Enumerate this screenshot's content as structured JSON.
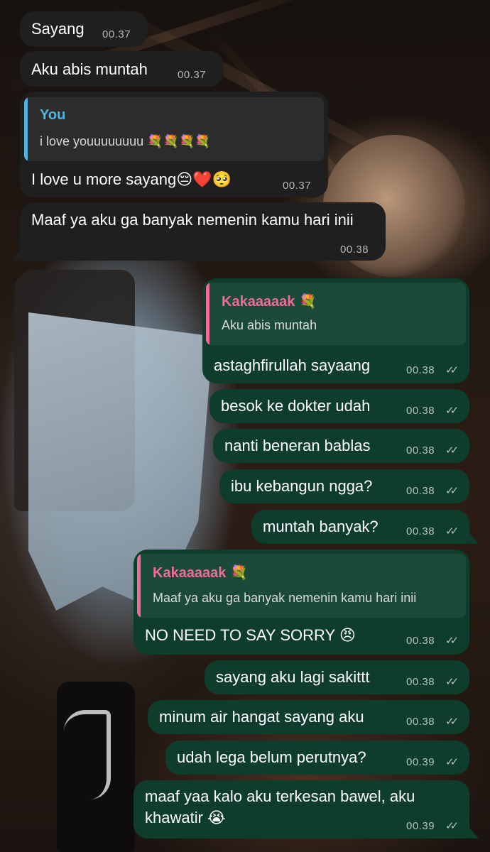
{
  "colors": {
    "incoming_bubble": "#1f1f1f",
    "outgoing_bubble": "#0f3d2c",
    "quote_you": "#4fb3e0",
    "quote_kakaaaak": "#f06a9a"
  },
  "incoming": [
    {
      "text": "Sayang",
      "time": "00.37"
    },
    {
      "text": "Aku abis muntah",
      "time": "00.37"
    },
    {
      "quote_name": "You",
      "quote_text": "i love youuuuuuuu 💐💐💐💐",
      "text": "I love u more sayang😔❤️🥺",
      "time": "00.37"
    },
    {
      "text": "Maaf ya aku ga banyak nemenin kamu hari inii",
      "time": "00.38"
    }
  ],
  "outgoing": [
    {
      "quote_name": "Kakaaaaak 💐",
      "quote_text": "Aku abis muntah",
      "text": "astaghfirullah sayaang",
      "time": "00.38"
    },
    {
      "text": "besok ke dokter udah",
      "time": "00.38"
    },
    {
      "text": "nanti beneran bablas",
      "time": "00.38"
    },
    {
      "text": "ibu kebangun ngga?",
      "time": "00.38"
    },
    {
      "text": "muntah banyak?",
      "time": "00.38"
    },
    {
      "quote_name": "Kakaaaaak 💐",
      "quote_text": "Maaf ya aku ga banyak nemenin kamu hari inii",
      "text": "NO NEED TO SAY SORRY 😠",
      "time": "00.38"
    },
    {
      "text": "sayang aku lagi sakittt",
      "time": "00.38"
    },
    {
      "text": "minum air hangat sayang aku",
      "time": "00.38"
    },
    {
      "text": "udah lega belum perutnya?",
      "time": "00.39"
    },
    {
      "text": "maaf yaa kalo aku terkesan bawel, aku khawatir 😭",
      "time": "00.39"
    }
  ],
  "read_ticks": "✓✓"
}
